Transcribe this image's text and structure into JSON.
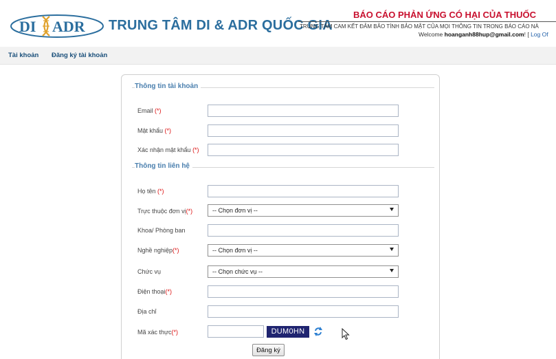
{
  "header": {
    "logo_text_left": "DI",
    "logo_text_right": "ADR",
    "center_name": "TRUNG TÂM DI & ADR QUỐC GIA",
    "report_title": "BÁO CÁO PHẢN ỨNG CÓ HẠI CỦA THUỐC",
    "commitment": "TRUNG TÂM CAM KẾT ĐẢM BẢO TÍNH BẢO MẬT CỦA MỌI THÔNG TIN TRONG BÁO CÁO NÀ",
    "welcome_prefix": "Welcome ",
    "user_email": "hoanganh88hup@gmail.com",
    "welcome_suffix": "! [ ",
    "logout": "Log Of"
  },
  "nav": {
    "items": [
      {
        "label": "Tài khoản"
      },
      {
        "label": "Đăng ký tài khoản"
      }
    ]
  },
  "form": {
    "sections": [
      {
        "title": "Thông tin tài khoản"
      },
      {
        "title": "Thông tin liên hệ"
      }
    ],
    "required_marker": "(*)",
    "fields": {
      "email": {
        "label": "Email ",
        "value": ""
      },
      "password": {
        "label": "Mật khẩu ",
        "value": ""
      },
      "confirm_password": {
        "label": "Xác nhận mật khẩu ",
        "value": ""
      },
      "full_name": {
        "label": "Họ tên ",
        "value": ""
      },
      "unit": {
        "label": "Trực thuộc đơn vị",
        "selected": "-- Chọn đơn vị --"
      },
      "department": {
        "label": "Khoa/ Phòng ban",
        "value": ""
      },
      "occupation": {
        "label": "Nghề nghiệp",
        "selected": "-- Chọn đơn vị --"
      },
      "position": {
        "label": "Chức vụ",
        "selected": "-- Chọn chức vụ --"
      },
      "phone": {
        "label": "Điện thoại",
        "value": ""
      },
      "address": {
        "label": "Địa chỉ",
        "value": ""
      },
      "captcha": {
        "label": "Mã xác thực",
        "code": "DUM0HN",
        "value": ""
      }
    },
    "submit_label": "Đăng ký"
  },
  "colors": {
    "brand_blue": "#2b6e9e",
    "report_red": "#c8102e",
    "required_red": "#dd1111",
    "captcha_bg": "#1f2470",
    "refresh_blue": "#2c7fd1"
  }
}
